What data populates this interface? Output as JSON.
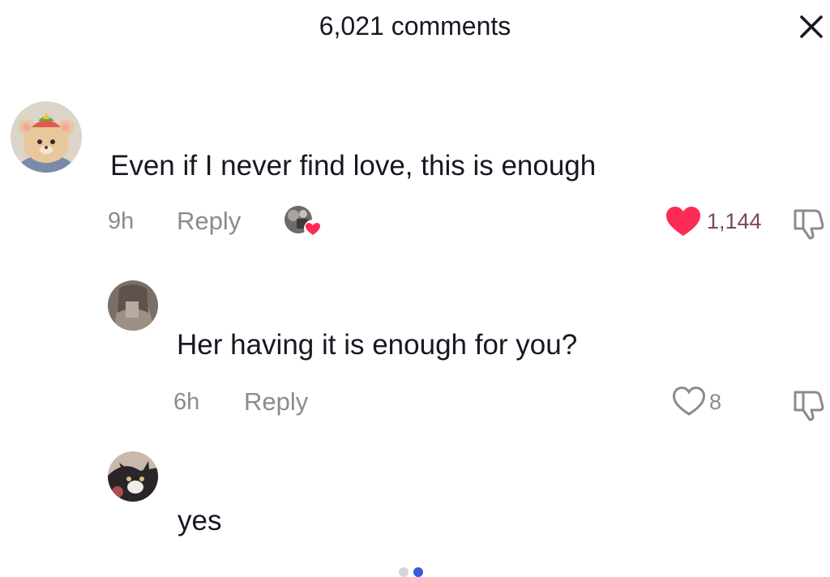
{
  "header": {
    "title": "6,021 comments",
    "close_icon": "close-icon"
  },
  "comments": [
    {
      "text": "Even if I never find love, this is enough",
      "time": "9h",
      "reply_label": "Reply",
      "likes": "1,144",
      "liked": true,
      "creator_liked": true,
      "avatar_icon": "hamster-avatar-icon"
    },
    {
      "text": "Her having it is enough for you?",
      "time": "6h",
      "reply_label": "Reply",
      "likes": "8",
      "liked": false,
      "avatar_icon": "user-avatar-icon"
    },
    {
      "text": "yes",
      "avatar_icon": "cat-avatar-icon"
    }
  ],
  "colors": {
    "like_red": "#fe2c55",
    "muted_text": "#8a8b91",
    "primary_text": "#161823",
    "liked_count": "#7d4658"
  }
}
